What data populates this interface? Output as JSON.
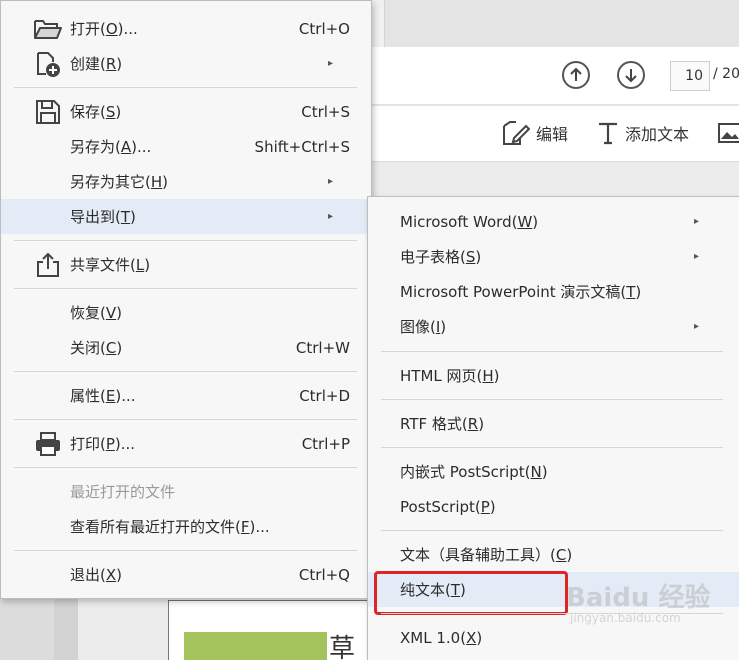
{
  "background": {
    "toolbar": {
      "page_current": "10",
      "page_total": "/ 20"
    },
    "edit_toolbar": {
      "edit_label": "编辑",
      "add_text_label": "添加文本"
    },
    "page_heading_char": "草"
  },
  "file_menu": {
    "items": [
      {
        "label": "打开(",
        "mnemonic": "O",
        "suffix": ")...",
        "shortcut": "Ctrl+O",
        "icon": "folder-open-icon"
      },
      {
        "label": "创建(",
        "mnemonic": "R",
        "suffix": ")",
        "shortcut": "",
        "icon": "create-icon",
        "submenu": true
      },
      {
        "label": "保存(",
        "mnemonic": "S",
        "suffix": ")",
        "shortcut": "Ctrl+S",
        "icon": "save-icon"
      },
      {
        "label": "另存为(",
        "mnemonic": "A",
        "suffix": ")...",
        "shortcut": "Shift+Ctrl+S"
      },
      {
        "label": "另存为其它(",
        "mnemonic": "H",
        "suffix": ")",
        "shortcut": "",
        "submenu": true
      },
      {
        "label": "导出到(",
        "mnemonic": "T",
        "suffix": ")",
        "shortcut": "",
        "submenu": true,
        "active": true
      },
      {
        "label": "共享文件(",
        "mnemonic": "L",
        "suffix": ")",
        "shortcut": "",
        "icon": "share-icon"
      },
      {
        "label": "恢复(",
        "mnemonic": "V",
        "suffix": ")",
        "shortcut": ""
      },
      {
        "label": "关闭(",
        "mnemonic": "C",
        "suffix": ")",
        "shortcut": "Ctrl+W"
      },
      {
        "label": "属性(",
        "mnemonic": "E",
        "suffix": ")...",
        "shortcut": "Ctrl+D"
      },
      {
        "label": "打印(",
        "mnemonic": "P",
        "suffix": ")...",
        "shortcut": "Ctrl+P",
        "icon": "printer-icon"
      },
      {
        "label": "最近打开的文件",
        "mnemonic": "",
        "suffix": "",
        "shortcut": "",
        "disabled": true
      },
      {
        "label": "查看所有最近打开的文件(",
        "mnemonic": "F",
        "suffix": ")...",
        "shortcut": ""
      },
      {
        "label": "退出(",
        "mnemonic": "X",
        "suffix": ")",
        "shortcut": "Ctrl+Q"
      }
    ]
  },
  "export_submenu": {
    "items": [
      {
        "label": "Microsoft Word(",
        "mnemonic": "W",
        "suffix": ")",
        "submenu": true
      },
      {
        "label": "电子表格(",
        "mnemonic": "S",
        "suffix": ")",
        "submenu": true
      },
      {
        "label": "Microsoft PowerPoint 演示文稿(",
        "mnemonic": "T",
        "suffix": ")"
      },
      {
        "label": "图像(",
        "mnemonic": "I",
        "suffix": ")",
        "submenu": true
      },
      {
        "label": "HTML 网页(",
        "mnemonic": "H",
        "suffix": ")"
      },
      {
        "label": "RTF 格式(",
        "mnemonic": "R",
        "suffix": ")"
      },
      {
        "label": "内嵌式 PostScript(",
        "mnemonic": "N",
        "suffix": ")"
      },
      {
        "label": "PostScript(",
        "mnemonic": "P",
        "suffix": ")"
      },
      {
        "label": "文本（具备辅助工具）(",
        "mnemonic": "C",
        "suffix": ")"
      },
      {
        "label": "纯文本(",
        "mnemonic": "T",
        "suffix": ")",
        "active": true
      },
      {
        "label": "XML 1.0(",
        "mnemonic": "X",
        "suffix": ")"
      }
    ]
  },
  "watermark": {
    "text": "Baidu 经验",
    "sub": "jingyan.baidu.com"
  },
  "colors": {
    "menu_bg": "#f7f7f7",
    "active_bg": "#e3ecf6",
    "highlight_border": "#e02424",
    "page_green": "#a5c35c"
  }
}
